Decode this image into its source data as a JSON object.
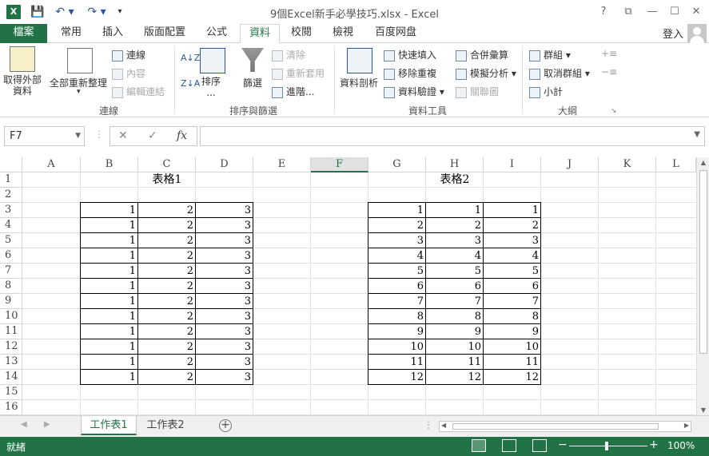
{
  "window": {
    "title": "9個Excel新手必學技巧.xlsx - Excel",
    "help": "?",
    "restore": "⧉",
    "minimize": "—",
    "maximize": "☐",
    "close": "✕"
  },
  "qat": {
    "save": "💾",
    "undo": "↶ ▾",
    "redo": "↷ ▾",
    "customize": "▾"
  },
  "tabs": [
    "檔案",
    "常用",
    "插入",
    "版面配置",
    "公式",
    "資料",
    "校閱",
    "檢視",
    "百度网盘"
  ],
  "active_tab": "資料",
  "account": {
    "login": "登入"
  },
  "ribbon": {
    "get_external": "取得外部\n資料",
    "refresh_all": "全部重新整理",
    "connections": "連線",
    "properties": "內容",
    "edit_links": "編輯連結",
    "group_connections": "連線",
    "sort_asc": "A↓Z",
    "sort_desc": "Z↓A",
    "sort": "排序\n...",
    "filter": "篩選",
    "clear": "清除",
    "reapply": "重新套用",
    "advanced": "進階...",
    "group_sort_filter": "排序與篩選",
    "text_to_columns": "資料剖析",
    "flash_fill": "快速填入",
    "remove_dups": "移除重複",
    "data_validation": "資料驗證",
    "consolidate": "合併彙算",
    "what_if": "模擬分析",
    "relationships": "關聯圖",
    "group_data_tools": "資料工具",
    "group": "群組",
    "ungroup": "取消群組",
    "subtotal": "小計",
    "group_outline": "大綱"
  },
  "formula_bar": {
    "name_box": "F7",
    "cancel": "✕",
    "enter": "✓",
    "fx": "fx",
    "value": ""
  },
  "columns": [
    "A",
    "B",
    "C",
    "D",
    "E",
    "F",
    "G",
    "H",
    "I",
    "J",
    "K",
    "L"
  ],
  "selected_column": "F",
  "rows": [
    "1",
    "2",
    "3",
    "4",
    "5",
    "6",
    "7",
    "8",
    "9",
    "10",
    "11",
    "12",
    "13",
    "14",
    "15",
    "16"
  ],
  "table1": {
    "title": "表格1",
    "rows": [
      [
        "1",
        "2",
        "3"
      ],
      [
        "1",
        "2",
        "3"
      ],
      [
        "1",
        "2",
        "3"
      ],
      [
        "1",
        "2",
        "3"
      ],
      [
        "1",
        "2",
        "3"
      ],
      [
        "1",
        "2",
        "3"
      ],
      [
        "1",
        "2",
        "3"
      ],
      [
        "1",
        "2",
        "3"
      ],
      [
        "1",
        "2",
        "3"
      ],
      [
        "1",
        "2",
        "3"
      ],
      [
        "1",
        "2",
        "3"
      ],
      [
        "1",
        "2",
        "3"
      ]
    ]
  },
  "table2": {
    "title": "表格2",
    "rows": [
      [
        "1",
        "1",
        "1"
      ],
      [
        "2",
        "2",
        "2"
      ],
      [
        "3",
        "3",
        "3"
      ],
      [
        "4",
        "4",
        "4"
      ],
      [
        "5",
        "5",
        "5"
      ],
      [
        "6",
        "6",
        "6"
      ],
      [
        "7",
        "7",
        "7"
      ],
      [
        "8",
        "8",
        "8"
      ],
      [
        "9",
        "9",
        "9"
      ],
      [
        "10",
        "10",
        "10"
      ],
      [
        "11",
        "11",
        "11"
      ],
      [
        "12",
        "12",
        "12"
      ]
    ]
  },
  "sheets": [
    "工作表1",
    "工作表2"
  ],
  "active_sheet": "工作表1",
  "status": {
    "ready": "就緒",
    "zoom": "100%",
    "minus": "−",
    "plus": "+"
  }
}
